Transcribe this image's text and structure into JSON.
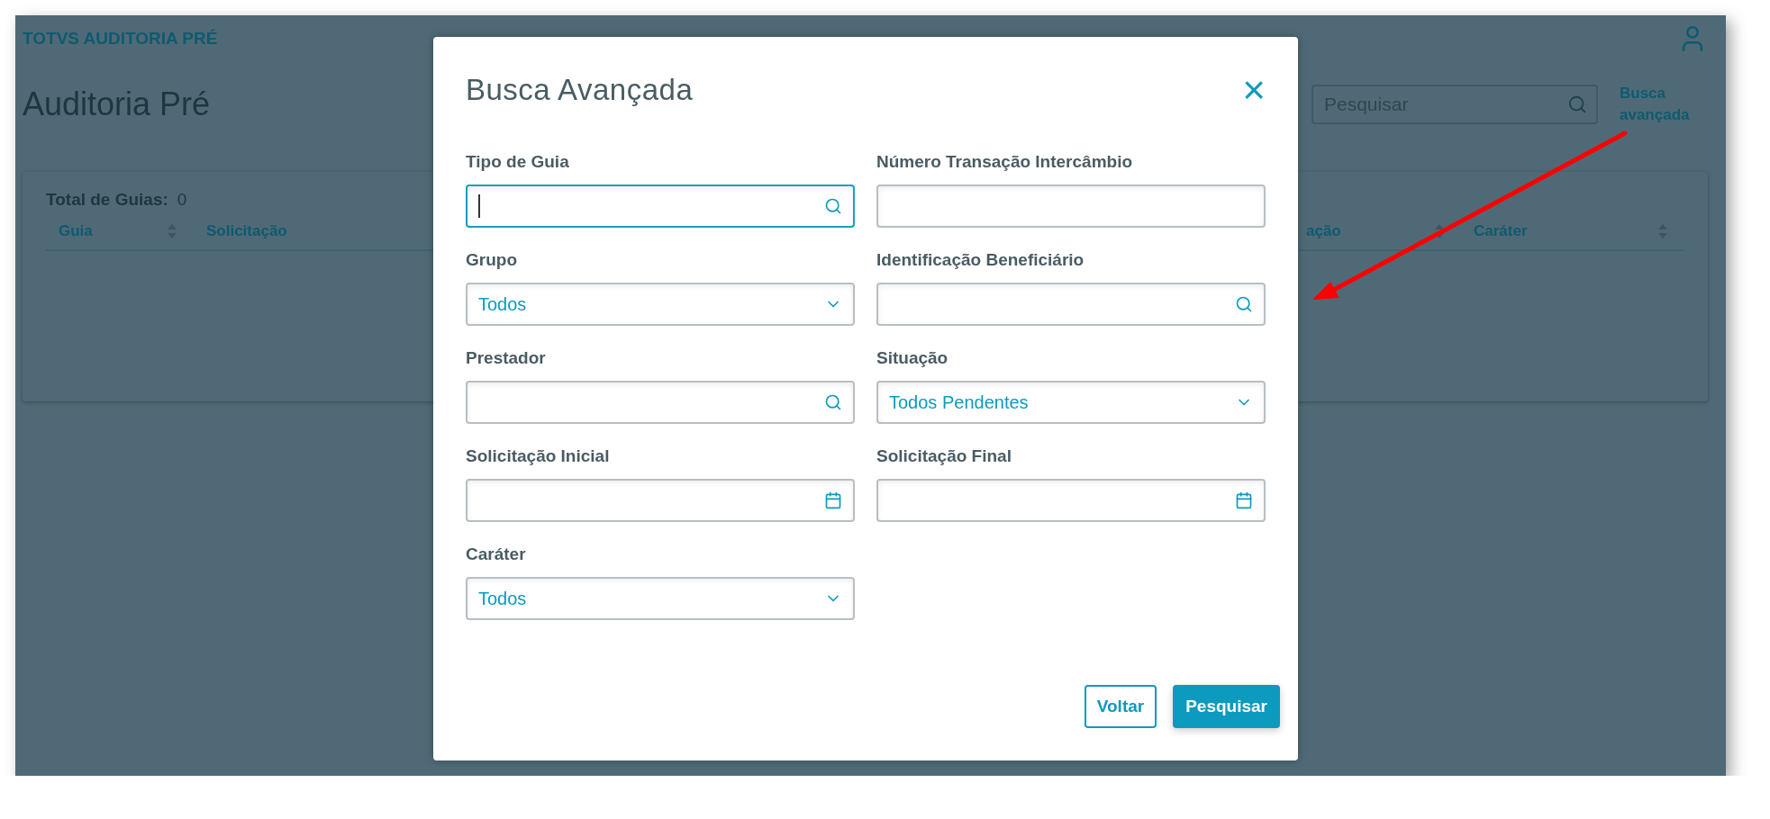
{
  "app": {
    "brand": "TOTVS AUDITORIA PRÉ",
    "title": "Auditoria Pré",
    "search": {
      "placeholder": "Pesquisar"
    },
    "advanced_link": "Busca avançada",
    "table": {
      "total_label": "Total de Guias:",
      "total_value": "0",
      "columns": [
        {
          "label": "Guia",
          "sortable": true
        },
        {
          "label": "Solicitação"
        },
        {
          "label": "ação",
          "sortable": true
        },
        {
          "label": "Caráter",
          "sortable": true
        }
      ]
    }
  },
  "dialog": {
    "title": "Busca Avançada",
    "close": "×",
    "fields": [
      {
        "label": "Tipo de Guia",
        "kind": "lookup",
        "focused": true
      },
      {
        "label": "Número Transação Intercâmbio",
        "kind": "text",
        "focused": false
      },
      {
        "label": "Grupo",
        "kind": "select",
        "value": "Todos",
        "focused": false
      },
      {
        "label": "Identificação Beneficiário",
        "kind": "lookup",
        "focused": false
      },
      {
        "label": "Prestador",
        "kind": "lookup",
        "focused": false
      },
      {
        "label": "Situação",
        "kind": "select",
        "value": "Todos Pendentes",
        "focused": false
      },
      {
        "label": "Solicitação Inicial",
        "kind": "date",
        "focused": false
      },
      {
        "label": "Solicitação Final",
        "kind": "date",
        "focused": false
      },
      {
        "label": "Caráter",
        "kind": "select",
        "value": "Todos",
        "focused": false
      }
    ],
    "buttons": [
      {
        "label": "Voltar",
        "kind": "secondary"
      },
      {
        "label": "Pesquisar",
        "kind": "primary"
      }
    ]
  }
}
